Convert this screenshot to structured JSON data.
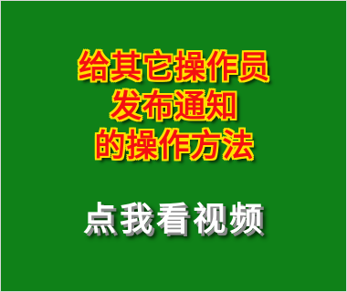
{
  "banner": {
    "title_lines": [
      "给其它操作员",
      "发布通知",
      "的操作方法"
    ],
    "cta_label": "点我看视频"
  },
  "colors": {
    "background": "#0f8118",
    "title_fill": "#f41010",
    "title_outline": "#ffe200",
    "cta_text": "#ffffff"
  }
}
